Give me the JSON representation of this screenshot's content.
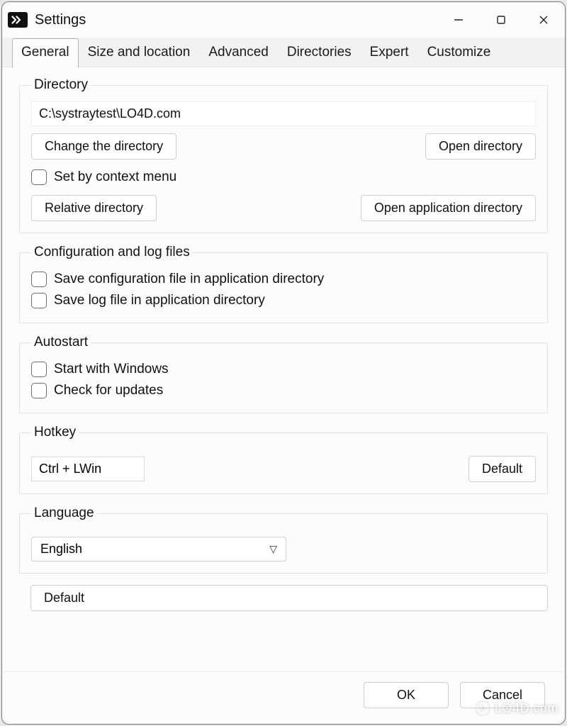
{
  "window": {
    "title": "Settings"
  },
  "tabs": {
    "t0": "General",
    "t1": "Size and location",
    "t2": "Advanced",
    "t3": "Directories",
    "t4": "Expert",
    "t5": "Customize"
  },
  "directory": {
    "legend": "Directory",
    "path": "C:\\systraytest\\LO4D.com",
    "change_btn": "Change the directory",
    "open_btn": "Open directory",
    "set_context": "Set by context menu",
    "relative_btn": "Relative directory",
    "open_app_btn": "Open application directory"
  },
  "config": {
    "legend": "Configuration and log files",
    "save_config": "Save configuration file in application directory",
    "save_log": "Save log file in application directory"
  },
  "autostart": {
    "legend": "Autostart",
    "start_win": "Start with Windows",
    "check_upd": "Check for updates"
  },
  "hotkey": {
    "legend": "Hotkey",
    "value": "Ctrl + LWin",
    "default_btn": "Default"
  },
  "language": {
    "legend": "Language",
    "value": "English"
  },
  "default_all": "Default",
  "footer": {
    "ok": "OK",
    "cancel": "Cancel"
  },
  "watermark": "LO4D.com"
}
